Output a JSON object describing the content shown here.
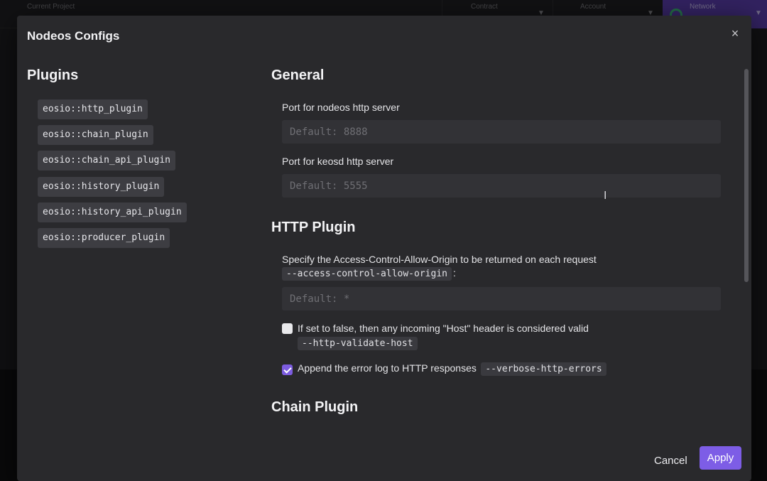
{
  "background": {
    "topbar": {
      "current_project_label": "Current Project",
      "contract_label": "Contract",
      "account_label": "Account",
      "network_label": "Network"
    }
  },
  "modal": {
    "title": "Nodeos Configs",
    "close_label": "×",
    "plugins": {
      "heading": "Plugins",
      "items": [
        "eosio::http_plugin",
        "eosio::chain_plugin",
        "eosio::chain_api_plugin",
        "eosio::history_plugin",
        "eosio::history_api_plugin",
        "eosio::producer_plugin"
      ]
    },
    "general": {
      "heading": "General",
      "nodeos_port_label": "Port for nodeos http server",
      "nodeos_port_placeholder": "Default: 8888",
      "nodeos_port_value": "",
      "keosd_port_label": "Port for keosd http server",
      "keosd_port_placeholder": "Default: 5555",
      "keosd_port_value": ""
    },
    "http_plugin": {
      "heading": "HTTP Plugin",
      "cors_label": "Specify the Access-Control-Allow-Origin to be returned on each request",
      "cors_flag": "--access-control-allow-origin",
      "cors_colon": ":",
      "cors_placeholder": "Default: *",
      "cors_value": "",
      "validate_host_label": "If set to false, then any incoming \"Host\" header is considered valid",
      "validate_host_flag": "--http-validate-host",
      "validate_host_checked": false,
      "verbose_errors_label": "Append the error log to HTTP responses",
      "verbose_errors_flag": "--verbose-http-errors",
      "verbose_errors_checked": true
    },
    "chain_plugin": {
      "heading": "Chain Plugin"
    },
    "footer": {
      "cancel_label": "Cancel",
      "apply_label": "Apply"
    }
  },
  "colors": {
    "accent": "#7d5de6",
    "modal_bg": "#29292c",
    "input_bg": "#323236",
    "chip_bg": "#3d3d42"
  }
}
